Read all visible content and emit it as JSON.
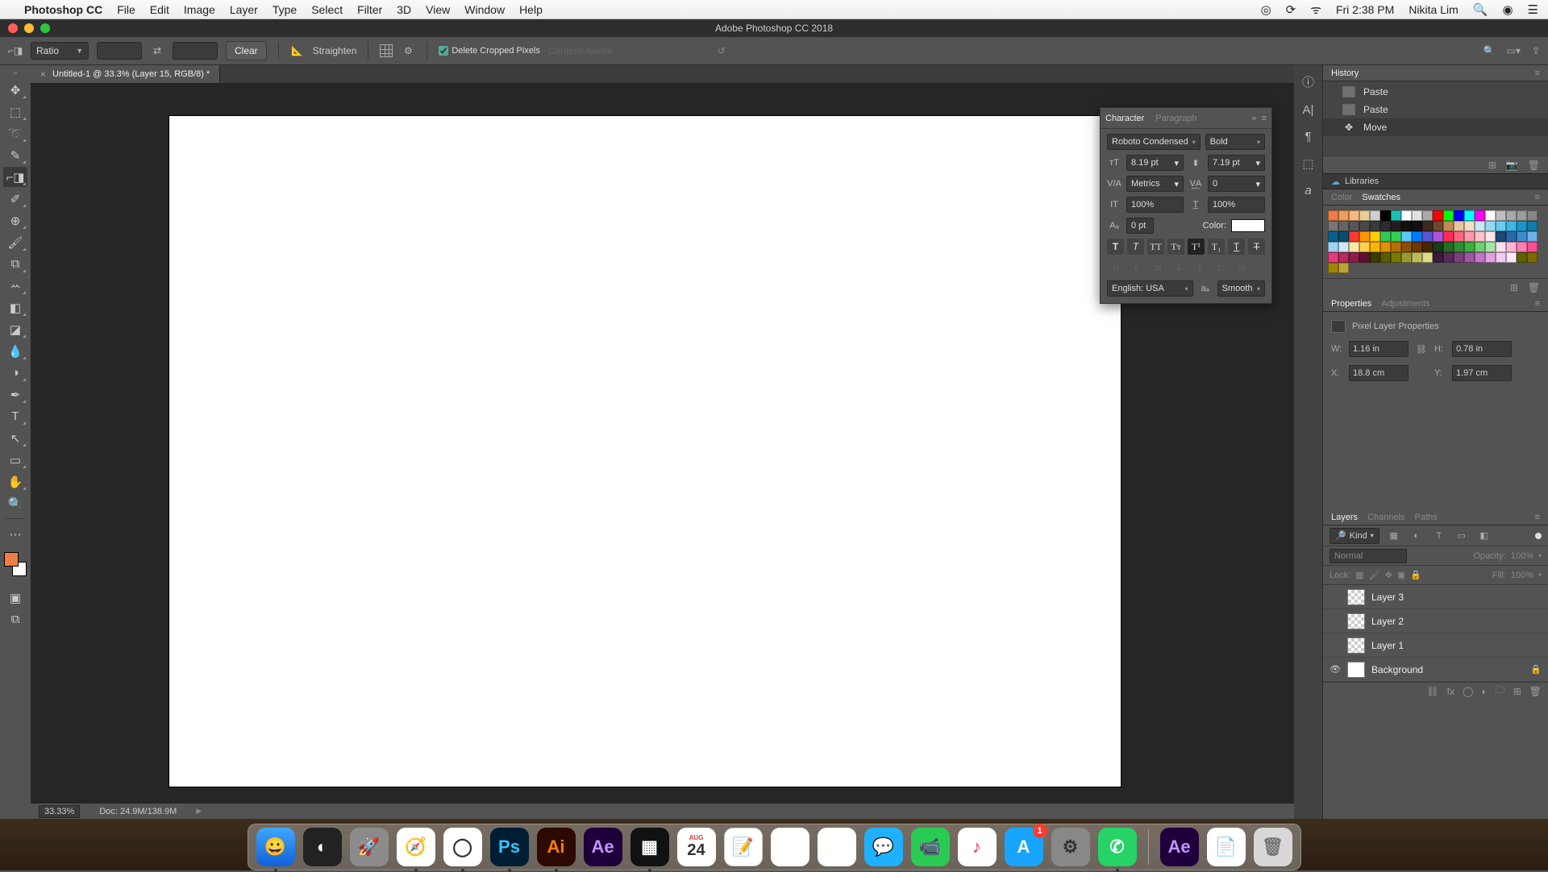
{
  "menubar": {
    "app": "Photoshop CC",
    "items": [
      "File",
      "Edit",
      "Image",
      "Layer",
      "Type",
      "Select",
      "Filter",
      "3D",
      "View",
      "Window",
      "Help"
    ],
    "right": {
      "clock": "Fri 2:38 PM",
      "user": "Nikita Lim"
    }
  },
  "window": {
    "title": "Adobe Photoshop CC 2018"
  },
  "optionbar": {
    "ratio_label": "Ratio",
    "clear_btn": "Clear",
    "straighten_btn": "Straighten",
    "delete_cropped": "Delete Cropped Pixels",
    "content_aware": "Content-Aware"
  },
  "document": {
    "tab": "Untitled-1 @ 33.3% (Layer 15, RGB/8) *",
    "zoom": "33.33%",
    "docinfo": "Doc: 24.9M/138.9M"
  },
  "character": {
    "tab1": "Character",
    "tab2": "Paragraph",
    "font": "Roboto Condensed",
    "style": "Bold",
    "size": "8.19 pt",
    "leading": "7.19 pt",
    "kerning": "Metrics",
    "tracking": "0",
    "vscale": "100%",
    "hscale": "100%",
    "baseline": "0 pt",
    "color_label": "Color:",
    "lang": "English: USA",
    "aa": "Smooth"
  },
  "panels": {
    "history": {
      "label": "History",
      "items": [
        "Paste",
        "Paste",
        "Move"
      ],
      "selected": 2
    },
    "libraries_label": "Libraries",
    "color_tab": "Color",
    "swatches_tab": "Swatches",
    "swatch_colors": [
      "#f07d45",
      "#f29a60",
      "#f6b97f",
      "#e9cf95",
      "#cfcfcf",
      "#000000",
      "#1abfb5",
      "#ffffff",
      "#e2e2e2",
      "#aaaaaa",
      "#ff0000",
      "#00ff00",
      "#0000ff",
      "#00ffff",
      "#ff00ff",
      "#ffffff",
      "#bfbfbf",
      "#a8a8a8",
      "#9c9c9c",
      "#878787",
      "#767676",
      "#646464",
      "#565656",
      "#494949",
      "#3a3a3a",
      "#2c2c2c",
      "#1e1e1e",
      "#101010",
      "#101010",
      "#3b2a1d",
      "#6b4a2c",
      "#c28a57",
      "#e7c49a",
      "#f4dfc6",
      "#c6e8f4",
      "#93daf2",
      "#68cbed",
      "#3ab8e4",
      "#1897c7",
      "#0f7da8",
      "#0a608a",
      "#0a4d6e",
      "#ff3b30",
      "#ff9500",
      "#ffcc00",
      "#34c759",
      "#30d158",
      "#5ac8fa",
      "#007aff",
      "#5856d6",
      "#af52de",
      "#ff2d55",
      "#ff6482",
      "#ff99aa",
      "#ffc1cc",
      "#ffe5ea",
      "#1d4775",
      "#2b6aa8",
      "#3e8ccf",
      "#6bb3e6",
      "#9fd3f2",
      "#cfe9f8",
      "#ffe7a3",
      "#ffd24d",
      "#ffb400",
      "#e09000",
      "#b76f00",
      "#8c4e00",
      "#6c3700",
      "#4a2600",
      "#1a3a1a",
      "#256b25",
      "#2f8f2f",
      "#3bb03b",
      "#6fd06f",
      "#a5e5a5",
      "#ffe0ee",
      "#ffb6d5",
      "#ff7fb4",
      "#ff4d94",
      "#e63a7b",
      "#b92a60",
      "#8a1e47",
      "#5c1230",
      "#3b3b00",
      "#5b5b00",
      "#7a7a00",
      "#9a9a30",
      "#bcbc5c",
      "#deda8a",
      "#3a1c3a",
      "#572a57",
      "#7a3e7a",
      "#9f57a0",
      "#c077c1",
      "#e1a0e2",
      "#f0cdee",
      "#fde8fa",
      "#626200",
      "#7e6b00",
      "#9f8800",
      "#b7a637"
    ],
    "properties_tab": "Properties",
    "adjustments_tab": "Adjustments",
    "pixel_layer_label": "Pixel Layer Properties",
    "dims": {
      "w_label": "W:",
      "w": "1.16 in",
      "h_label": "H:",
      "h": "0.78 in",
      "x_label": "X:",
      "x": "18.8 cm",
      "y_label": "Y:",
      "y": "1.97 cm"
    },
    "layers_tab": "Layers",
    "channels_tab": "Channels",
    "paths_tab": "Paths",
    "kind_label": "Kind",
    "blend_mode": "Normal",
    "opacity_label": "Opacity:",
    "opacity": "100%",
    "lock_label": "Lock:",
    "fill_label": "Fill:",
    "fill": "100%",
    "layers": [
      {
        "name": "Layer 3",
        "visible": false,
        "chk": true,
        "locked": false
      },
      {
        "name": "Layer 2",
        "visible": false,
        "chk": true,
        "locked": false
      },
      {
        "name": "Layer 1",
        "visible": false,
        "chk": true,
        "locked": false
      },
      {
        "name": "Background",
        "visible": true,
        "chk": false,
        "locked": true
      }
    ]
  },
  "dock": {
    "apps": [
      {
        "id": "finder",
        "label": "😀",
        "active": true
      },
      {
        "id": "siri",
        "label": "◐",
        "active": false
      },
      {
        "id": "launch",
        "label": "🚀",
        "active": false
      },
      {
        "id": "safari",
        "label": "🧭",
        "active": true
      },
      {
        "id": "chrome",
        "label": "◯",
        "active": true
      },
      {
        "id": "ps",
        "label": "Ps",
        "active": true
      },
      {
        "id": "ai",
        "label": "Ai",
        "active": true
      },
      {
        "id": "ae",
        "label": "Ae",
        "active": false
      },
      {
        "id": "pix",
        "label": "▦",
        "active": true
      },
      {
        "id": "cal",
        "label": "24",
        "active": false,
        "tag": "AUG"
      },
      {
        "id": "notes",
        "label": "📝",
        "active": false
      },
      {
        "id": "rem",
        "label": "☲",
        "active": false
      },
      {
        "id": "photos",
        "label": "✿",
        "active": false
      },
      {
        "id": "msgs",
        "label": "💬",
        "active": false
      },
      {
        "id": "ft",
        "label": "📹",
        "active": false
      },
      {
        "id": "music",
        "label": "♪",
        "active": false
      },
      {
        "id": "store",
        "label": "A",
        "active": false,
        "badge": true
      },
      {
        "id": "set",
        "label": "⚙",
        "active": false
      },
      {
        "id": "wa",
        "label": "✆",
        "active": true
      }
    ],
    "right_apps": [
      {
        "id": "ae2",
        "label": "Ae"
      },
      {
        "id": "doc",
        "label": "📄"
      },
      {
        "id": "trash",
        "label": "🗑"
      }
    ]
  }
}
